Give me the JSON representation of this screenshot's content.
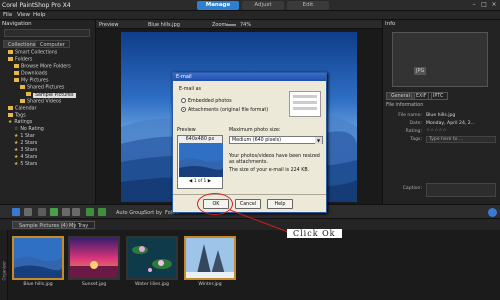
{
  "app": {
    "title": "Corel PaintShop Pro X4"
  },
  "window_tabs": {
    "manage": "Manage",
    "adjust": "Adjust",
    "edit": "Edit"
  },
  "menu": {
    "file": "File",
    "view": "View",
    "help": "Help"
  },
  "navigation": {
    "title": "Navigation",
    "tabs": {
      "collections": "Collections",
      "computer": "Computer"
    },
    "tree": [
      "Smart Collections",
      "Folders",
      "Browse More Folders",
      "Downloads",
      "My Pictures",
      "Shared Pictures",
      "Sample Pictures",
      "Shared Videos",
      "Calendar",
      "Tags",
      "Ratings",
      "No Rating",
      "1 Star",
      "2 Stars",
      "3 Stars",
      "4 Stars",
      "5 Stars"
    ]
  },
  "viewer": {
    "mode": "Preview",
    "filename": "Blue hills.jpg",
    "zoom_label": "Zoom:",
    "zoom": "74%"
  },
  "info_panel": {
    "title": "Info",
    "thumb_label": "JPG",
    "tabs": {
      "general": "General",
      "exif": "EXIF",
      "iptc": "IPTC"
    },
    "section": "File information",
    "fields": [
      {
        "label": "File name:",
        "value": "Blue hills.jpg"
      },
      {
        "label": "Date:",
        "value": "Monday, April 24, 2..."
      },
      {
        "label": "Rating:",
        "value": "☆☆☆☆☆"
      },
      {
        "label": "Tags:",
        "value": "Type here to ..."
      },
      {
        "label": "Caption:",
        "value": ""
      }
    ]
  },
  "toolbar": {
    "auto_group": "Auto Group",
    "sort_by": "Sort by",
    "folder": "Folder"
  },
  "tray": {
    "tabs": {
      "sample": "Sample Pictures (4)",
      "my_tray": "My Tray"
    },
    "organizer": "Organizer",
    "thumbnails": [
      "Blue hills.jpg",
      "Sunset.jpg",
      "Water lilies.jpg",
      "Winter.jpg"
    ]
  },
  "dialog": {
    "title": "E-mail",
    "email_as": "E-mail as",
    "opt_embedded": "Embedded photos",
    "opt_attachments": "Attachments (original file format)",
    "preview_label": "Preview",
    "preview_size": "640x480 px",
    "max_size_label": "Maximum photo size:",
    "max_size_value": "Medium (640 pixels)",
    "note": "Your photos/videos have been resized as attachments.",
    "size_note": "The size of your e-mail is 224 KB.",
    "pager": "1 of 1",
    "ok": "OK",
    "cancel": "Cancel",
    "help": "Help"
  },
  "annotation": {
    "text": "Click  Ok"
  },
  "colors": {
    "accent": "#2f7fd0",
    "callout": "#d21d1d",
    "selection": "#c98a2a"
  }
}
